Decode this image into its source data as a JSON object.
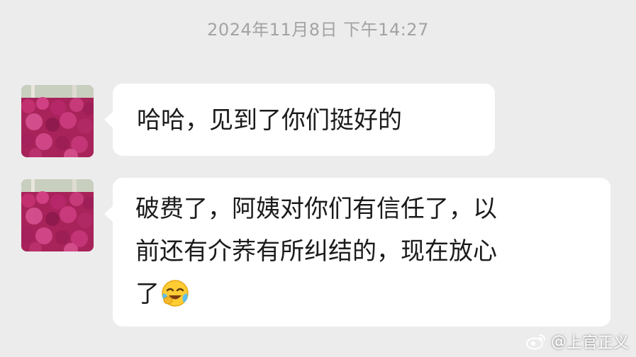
{
  "chat": {
    "timestamp": "2024年11月8日 下午14:27",
    "messages": [
      {
        "avatar_icon": "pink-flowers-avatar",
        "lines": [
          "哈哈，见到了你们挺好的"
        ]
      },
      {
        "avatar_icon": "pink-flowers-avatar",
        "lines": [
          "破费了，阿姨对你们有信任了，以",
          "前还有介荞有所纠结的，现在放心",
          "了"
        ],
        "emoji": "laughing-crying-face-icon"
      }
    ]
  },
  "watermark": {
    "prefix": "@",
    "handle": "上官正义",
    "icon": "weibo-logo-icon"
  },
  "colors": {
    "background": "#ececec",
    "bubble": "#ffffff",
    "timestamp": "#a3a3a3",
    "avatar_flowers": "#b3245f"
  }
}
